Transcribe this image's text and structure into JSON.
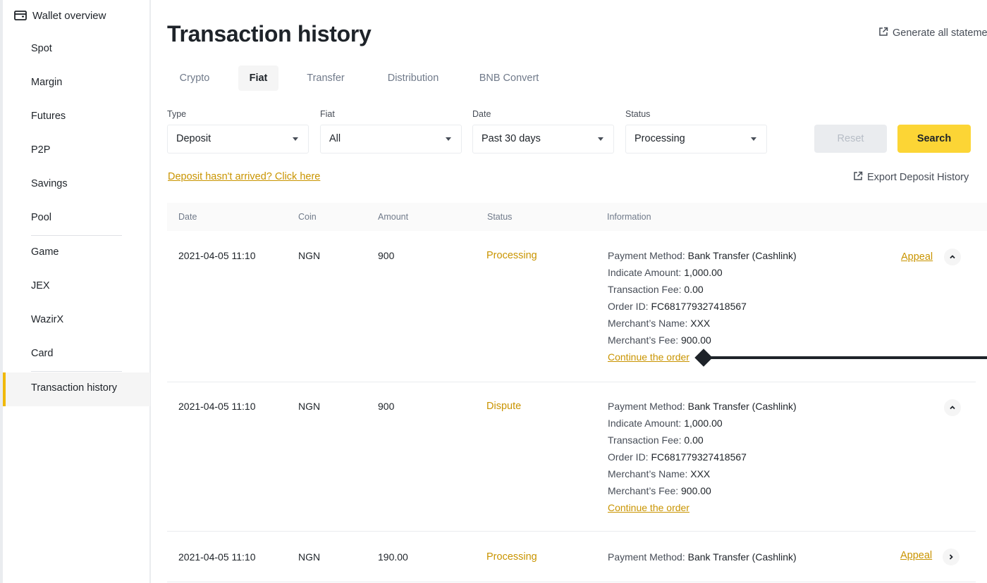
{
  "sidebar": {
    "header": "Wallet overview",
    "items": [
      "Spot",
      "Margin",
      "Futures",
      "P2P",
      "Savings",
      "Pool",
      "Game",
      "JEX",
      "WazirX",
      "Card"
    ],
    "active": "Transaction history"
  },
  "header": {
    "title": "Transaction history",
    "generate": "Generate all stateme"
  },
  "tabs": [
    "Crypto",
    "Fiat",
    "Transfer",
    "Distribution",
    "BNB Convert"
  ],
  "active_tab": "Fiat",
  "filters": {
    "type": {
      "label": "Type",
      "value": "Deposit"
    },
    "fiat": {
      "label": "Fiat",
      "value": "All"
    },
    "date": {
      "label": "Date",
      "value": "Past 30 days"
    },
    "status": {
      "label": "Status",
      "value": "Processing"
    }
  },
  "buttons": {
    "reset": "Reset",
    "search": "Search"
  },
  "links": {
    "deposit_help": "Deposit hasn't arrived? Click here",
    "export": "Export Deposit History"
  },
  "table": {
    "headers": [
      "Date",
      "Coin",
      "Amount",
      "Status",
      "Information"
    ],
    "info_labels": {
      "payment_method": "Payment Method:",
      "indicate_amount": "Indicate Amount:",
      "transaction_fee": "Transaction Fee:",
      "order_id": "Order ID:",
      "merchant_name": "Merchant’s Name:",
      "merchant_fee": "Merchant’s Fee:"
    },
    "rows": [
      {
        "date": "2021-04-05 11:10",
        "coin": "NGN",
        "amount": "900",
        "status": "Processing",
        "payment_method": "Bank Transfer (Cashlink)",
        "indicate_amount": "1,000.00",
        "transaction_fee": "0.00",
        "order_id": "FC681779327418567",
        "merchant_name": "XXX",
        "merchant_fee": "900.00",
        "continue": "Continue the order",
        "appeal": "Appeal"
      },
      {
        "date": "2021-04-05 11:10",
        "coin": "NGN",
        "amount": "900",
        "status": "Dispute",
        "payment_method": "Bank Transfer (Cashlink)",
        "indicate_amount": "1,000.00",
        "transaction_fee": "0.00",
        "order_id": "FC681779327418567",
        "merchant_name": "XXX",
        "merchant_fee": "900.00",
        "continue": "Continue the order"
      },
      {
        "date": "2021-04-05 11:10",
        "coin": "NGN",
        "amount": "190.00",
        "status": "Processing",
        "payment_method": "Bank Transfer (Cashlink)",
        "appeal": "Appeal"
      }
    ]
  },
  "icons": {
    "wallet": "wallet-icon",
    "external": "external-link-icon",
    "chevron_up": "chevron-up-icon",
    "chevron_right": "chevron-right-icon"
  },
  "colors": {
    "accent": "#f0b90b",
    "search_button": "#fcd535",
    "status": "#c99400",
    "text": "#1e2329",
    "muted": "#707a8a"
  }
}
